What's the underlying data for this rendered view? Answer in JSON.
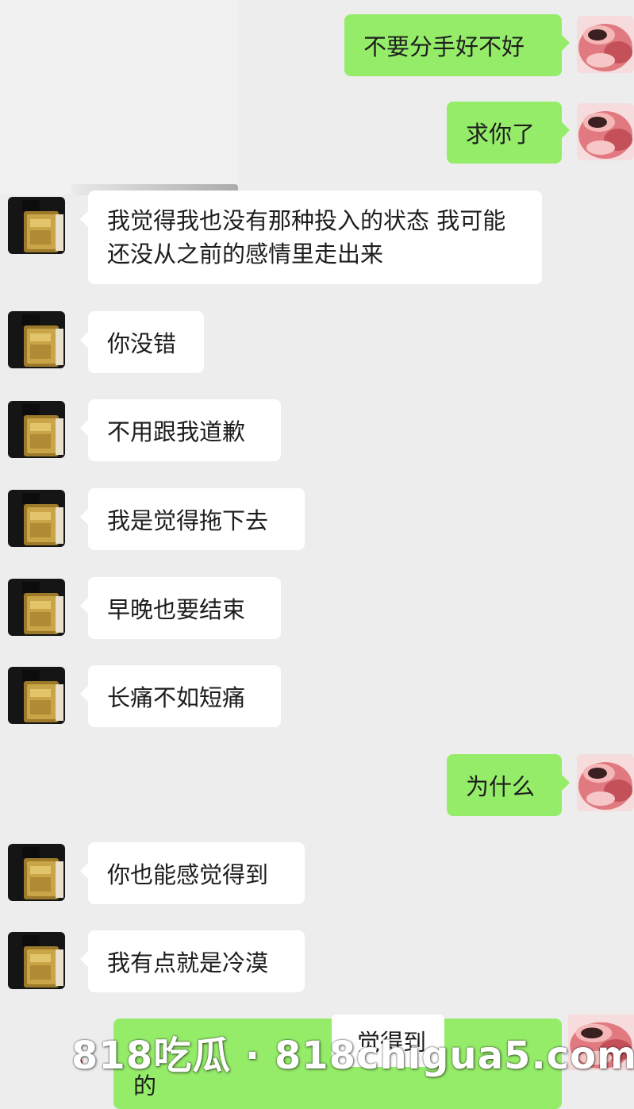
{
  "conversation": {
    "messages": [
      {
        "side": "out",
        "text": "不要分手好不好"
      },
      {
        "side": "out",
        "text": "求你了"
      },
      {
        "side": "in",
        "text": "我觉得我也没有那种投入的状态 我可能还没从之前的感情里走出来"
      },
      {
        "side": "in",
        "text": "你没错"
      },
      {
        "side": "in",
        "text": "不用跟我道歉"
      },
      {
        "side": "in",
        "text": "我是觉得拖下去"
      },
      {
        "side": "in",
        "text": "早晚也要结束"
      },
      {
        "side": "in",
        "text": "长痛不如短痛"
      },
      {
        "side": "out",
        "text": "为什么"
      },
      {
        "side": "in",
        "text": "你也能感觉得到"
      },
      {
        "side": "in",
        "text": "我有点就是冷漠"
      }
    ],
    "last_partial": {
      "visible_text_right": "觉得到",
      "visible_text_bottom": "的"
    }
  },
  "avatars": {
    "incoming_icon": "perfume-bottle-avatar",
    "outgoing_icon": "cartoon-red-avatar"
  },
  "watermark": {
    "text": "818吃瓜 · 818chigua5.com"
  },
  "colors": {
    "background": "#ededed",
    "incoming_bubble": "#ffffff",
    "outgoing_bubble": "#95ec69",
    "text": "#1d1d1d"
  }
}
